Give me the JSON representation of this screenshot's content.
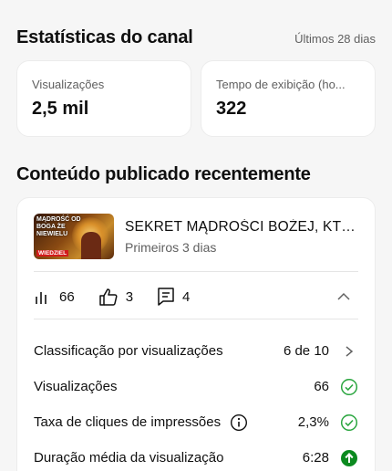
{
  "channel_stats": {
    "title": "Estatísticas do canal",
    "period": "Últimos 28 dias",
    "cards": [
      {
        "label": "Visualizações",
        "value": "2,5 mil"
      },
      {
        "label": "Tempo de exibição (ho...",
        "value": "322"
      }
    ]
  },
  "recent": {
    "title": "Conteúdo publicado recentemente",
    "video": {
      "thumbnail_text_top": "MĄDROŚĆ OD BOGA ŻE NIEWIELU",
      "thumbnail_text_bottom": "WIEDZIEL",
      "title": "SEKRET MĄDROŚCI BOŻEJ, KTÓR...",
      "subtitle": "Primeiros 3 dias"
    },
    "metrics": {
      "views": "66",
      "likes": "3",
      "comments": "4"
    },
    "rows": [
      {
        "label": "Classificação por visualizações",
        "value": "6 de 10",
        "icon": "chevron-right-icon"
      },
      {
        "label": "Visualizações",
        "value": "66",
        "icon": "check-circle-icon"
      },
      {
        "label": "Taxa de cliques de impressões",
        "value": "2,3%",
        "icon": "check-circle-icon"
      },
      {
        "label": "Duração média da visualização",
        "value": "6:28",
        "icon": "arrow-up-circle-icon"
      }
    ]
  },
  "colors": {
    "green": "#2ba640",
    "green_dark": "#0b8a1f",
    "muted": "#606060"
  }
}
